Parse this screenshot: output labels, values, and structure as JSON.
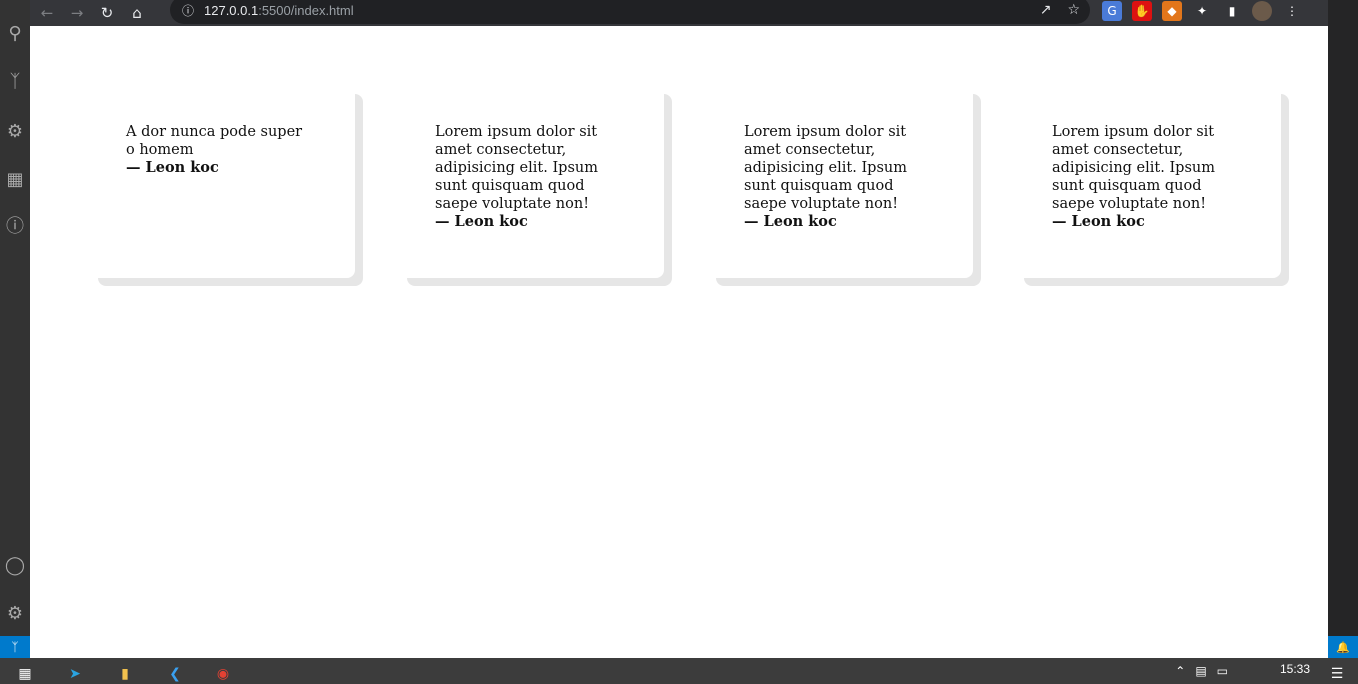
{
  "browser": {
    "url_host": "127.0.0.1",
    "url_rest": ":5500/index.html"
  },
  "cards": [
    {
      "quote": "A dor nunca pode super o homem",
      "author": "— Leon koc"
    },
    {
      "quote": "Lorem ipsum dolor sit amet consectetur, adipisicing elit. Ipsum sunt quisquam quod saepe voluptate non!",
      "author": "— Leon koc"
    },
    {
      "quote": "Lorem ipsum dolor sit amet consectetur, adipisicing elit. Ipsum sunt quisquam quod saepe voluptate non!",
      "author": "— Leon koc"
    },
    {
      "quote": "Lorem ipsum dolor sit amet consectetur, adipisicing elit. Ipsum sunt quisquam quod saepe voluptate non!",
      "author": "— Leon koc"
    }
  ],
  "taskbar": {
    "clock": "15:33"
  },
  "colors": {
    "card_shadow": "#e6e6e6",
    "vscode_status": "#007acc",
    "toolbar": "#35363a"
  }
}
